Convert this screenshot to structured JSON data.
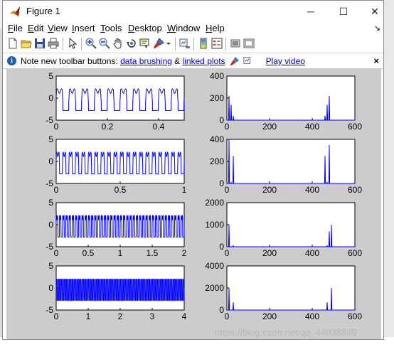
{
  "window": {
    "title": "Figure 1",
    "controls": {
      "minimize": "─",
      "maximize": "☐",
      "close": "✕"
    }
  },
  "menu": {
    "items": [
      {
        "key": "F",
        "rest": "ile"
      },
      {
        "key": "E",
        "rest": "dit"
      },
      {
        "key": "V",
        "rest": "iew"
      },
      {
        "key": "I",
        "rest": "nsert"
      },
      {
        "key": "T",
        "rest": "ools"
      },
      {
        "key": "D",
        "rest": "esktop"
      },
      {
        "key": "W",
        "rest": "indow"
      },
      {
        "key": "H",
        "rest": "elp"
      }
    ],
    "overflow_arrow": "↘"
  },
  "toolbar": {
    "icons": [
      "new-figure-icon",
      "open-file-icon",
      "save-icon",
      "print-icon",
      "edit-plot-arrow-icon",
      "zoom-in-icon",
      "zoom-out-icon",
      "pan-hand-icon",
      "rotate-3d-icon",
      "data-cursor-icon",
      "brush-icon",
      "brush-dropdown-icon",
      "link-plot-icon",
      "insert-colorbar-icon",
      "insert-legend-icon",
      "hide-plot-tools-icon",
      "show-plot-tools-icon"
    ]
  },
  "infobar": {
    "prefix": "Note new toolbar buttons: ",
    "link1": "data brushing",
    "amp": " & ",
    "link2": "linked plots",
    "link3": "Play video",
    "close": "×"
  },
  "chart_data": [
    {
      "type": "line",
      "xlim": [
        0,
        0.5
      ],
      "ylim": [
        -5,
        5
      ],
      "xticks": [
        "0",
        "0.2",
        "0.4"
      ],
      "yticks": [
        "-5",
        "0",
        "5"
      ],
      "description_series": "square-like periodic wave, ~10 cycles, y between -3 and 2"
    },
    {
      "type": "line",
      "xlim": [
        0,
        600
      ],
      "ylim": [
        0,
        400
      ],
      "xticks": [
        "0",
        "200",
        "400",
        "600"
      ],
      "yticks": [
        "0",
        "200",
        "400"
      ],
      "peaks": [
        {
          "x": 10,
          "y": 220
        },
        {
          "x": 20,
          "y": 140
        },
        {
          "x": 30,
          "y": 40
        },
        {
          "x": 460,
          "y": 40
        },
        {
          "x": 470,
          "y": 140
        },
        {
          "x": 480,
          "y": 220
        }
      ]
    },
    {
      "type": "line",
      "xlim": [
        0,
        1
      ],
      "ylim": [
        -5,
        5
      ],
      "xticks": [
        "0",
        "0.5",
        "1"
      ],
      "yticks": [
        "-5",
        "0",
        "5"
      ],
      "description_series": "square-like periodic wave, ~20 cycles"
    },
    {
      "type": "line",
      "xlim": [
        0,
        600
      ],
      "ylim": [
        0,
        400
      ],
      "xticks": [
        "0",
        "200",
        "400",
        "600"
      ],
      "yticks": [
        "0",
        "200",
        "400"
      ],
      "peaks": [
        {
          "x": 10,
          "y": 400
        },
        {
          "x": 20,
          "y": 10
        },
        {
          "x": 30,
          "y": 250
        },
        {
          "x": 460,
          "y": 250
        },
        {
          "x": 470,
          "y": 10
        },
        {
          "x": 480,
          "y": 350
        }
      ]
    },
    {
      "type": "line",
      "xlim": [
        0,
        2
      ],
      "ylim": [
        -5,
        5
      ],
      "xticks": [
        "0",
        "0.5",
        "1",
        "1.5",
        "2"
      ],
      "yticks": [
        "-5",
        "0",
        "5"
      ],
      "description_series": "dense square-like wave, ~40 cycles"
    },
    {
      "type": "line",
      "xlim": [
        0,
        600
      ],
      "ylim": [
        0,
        2000
      ],
      "xticks": [
        "0",
        "200",
        "400",
        "600"
      ],
      "yticks": [
        "0",
        "1000",
        "2000"
      ],
      "peaks": [
        {
          "x": 10,
          "y": 1000
        },
        {
          "x": 20,
          "y": 5
        },
        {
          "x": 30,
          "y": 50
        },
        {
          "x": 470,
          "y": 50
        },
        {
          "x": 480,
          "y": 700
        },
        {
          "x": 490,
          "y": 1000
        }
      ]
    },
    {
      "type": "line",
      "xlim": [
        0,
        4
      ],
      "ylim": [
        -5,
        5
      ],
      "xticks": [
        "0",
        "1",
        "2",
        "3",
        "4"
      ],
      "yticks": [
        "-5",
        "0",
        "5"
      ],
      "description_series": "very dense square-like wave, ~80 cycles"
    },
    {
      "type": "line",
      "xlim": [
        0,
        600
      ],
      "ylim": [
        0,
        4000
      ],
      "xticks": [
        "0",
        "200",
        "400",
        "600"
      ],
      "yticks": [
        "0",
        "2000",
        "4000"
      ],
      "peaks": [
        {
          "x": 10,
          "y": 2000
        },
        {
          "x": 30,
          "y": 700
        },
        {
          "x": 470,
          "y": 700
        },
        {
          "x": 490,
          "y": 2000
        }
      ]
    }
  ],
  "watermark": "https://blog.csdn.net/qq_44038899"
}
